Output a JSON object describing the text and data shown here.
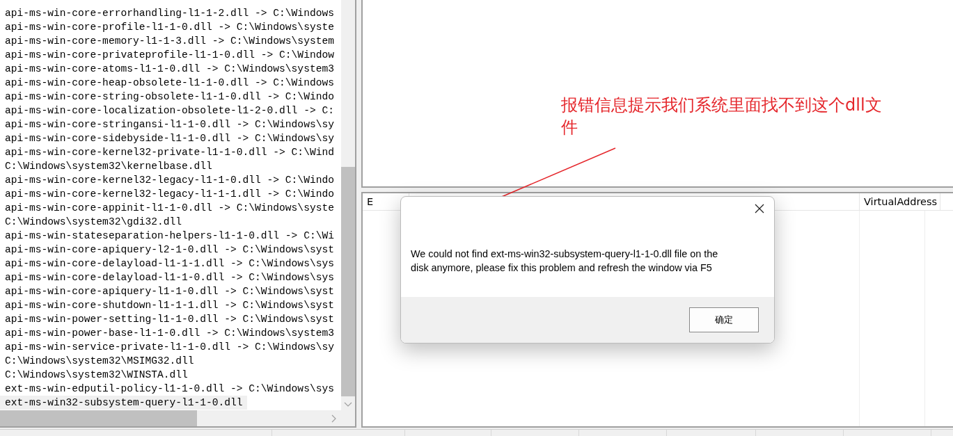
{
  "log_lines": [
    {
      "text": "api-ms-win-core-errorhandling-l1-1-2.dll -> C:\\Windows",
      "selected": false
    },
    {
      "text": "api-ms-win-core-profile-l1-1-0.dll -> C:\\Windows\\syste",
      "selected": false
    },
    {
      "text": "api-ms-win-core-memory-l1-1-3.dll -> C:\\Windows\\system",
      "selected": false
    },
    {
      "text": "api-ms-win-core-privateprofile-l1-1-0.dll -> C:\\Window",
      "selected": false
    },
    {
      "text": "api-ms-win-core-atoms-l1-1-0.dll -> C:\\Windows\\system3",
      "selected": false
    },
    {
      "text": "api-ms-win-core-heap-obsolete-l1-1-0.dll -> C:\\Windows",
      "selected": false
    },
    {
      "text": "api-ms-win-core-string-obsolete-l1-1-0.dll -> C:\\Windo",
      "selected": false
    },
    {
      "text": "api-ms-win-core-localization-obsolete-l1-2-0.dll -> C:",
      "selected": false
    },
    {
      "text": "api-ms-win-core-stringansi-l1-1-0.dll -> C:\\Windows\\sy",
      "selected": false
    },
    {
      "text": "api-ms-win-core-sidebyside-l1-1-0.dll -> C:\\Windows\\sy",
      "selected": false
    },
    {
      "text": "api-ms-win-core-kernel32-private-l1-1-0.dll -> C:\\Wind",
      "selected": false
    },
    {
      "text": "C:\\Windows\\system32\\kernelbase.dll",
      "selected": false
    },
    {
      "text": "api-ms-win-core-kernel32-legacy-l1-1-0.dll -> C:\\Windo",
      "selected": false
    },
    {
      "text": "api-ms-win-core-kernel32-legacy-l1-1-1.dll -> C:\\Windo",
      "selected": false
    },
    {
      "text": "api-ms-win-core-appinit-l1-1-0.dll -> C:\\Windows\\syste",
      "selected": false
    },
    {
      "text": "C:\\Windows\\system32\\gdi32.dll",
      "selected": false
    },
    {
      "text": "api-ms-win-stateseparation-helpers-l1-1-0.dll -> C:\\Wi",
      "selected": false
    },
    {
      "text": "api-ms-win-core-apiquery-l2-1-0.dll -> C:\\Windows\\syst",
      "selected": false
    },
    {
      "text": "api-ms-win-core-delayload-l1-1-1.dll -> C:\\Windows\\sys",
      "selected": false
    },
    {
      "text": "api-ms-win-core-delayload-l1-1-0.dll -> C:\\Windows\\sys",
      "selected": false
    },
    {
      "text": "api-ms-win-core-apiquery-l1-1-0.dll -> C:\\Windows\\syst",
      "selected": false
    },
    {
      "text": "api-ms-win-core-shutdown-l1-1-1.dll -> C:\\Windows\\syst",
      "selected": false
    },
    {
      "text": "api-ms-win-power-setting-l1-1-0.dll -> C:\\Windows\\syst",
      "selected": false
    },
    {
      "text": "api-ms-win-power-base-l1-1-0.dll -> C:\\Windows\\system3",
      "selected": false
    },
    {
      "text": "api-ms-win-service-private-l1-1-0.dll -> C:\\Windows\\sy",
      "selected": false
    },
    {
      "text": "C:\\Windows\\system32\\MSIMG32.dll",
      "selected": false
    },
    {
      "text": "C:\\Windows\\system32\\WINSTA.dll",
      "selected": false
    },
    {
      "text": "ext-ms-win-edputil-policy-l1-1-0.dll -> C:\\Windows\\sys",
      "selected": false
    },
    {
      "text": "ext-ms-win32-subsystem-query-l1-1-0.dll",
      "selected": true
    }
  ],
  "table": {
    "columns": [
      "E",
      "VirtualAddress"
    ]
  },
  "annotation": {
    "text": "报错信息提示我们系统里面找不到这个dll文件"
  },
  "dialog": {
    "message": "We could not find ext-ms-win32-subsystem-query-l1-1-0.dll file on the disk anymore, please fix this problem and refresh the window via F5",
    "ok_button": "确定"
  }
}
